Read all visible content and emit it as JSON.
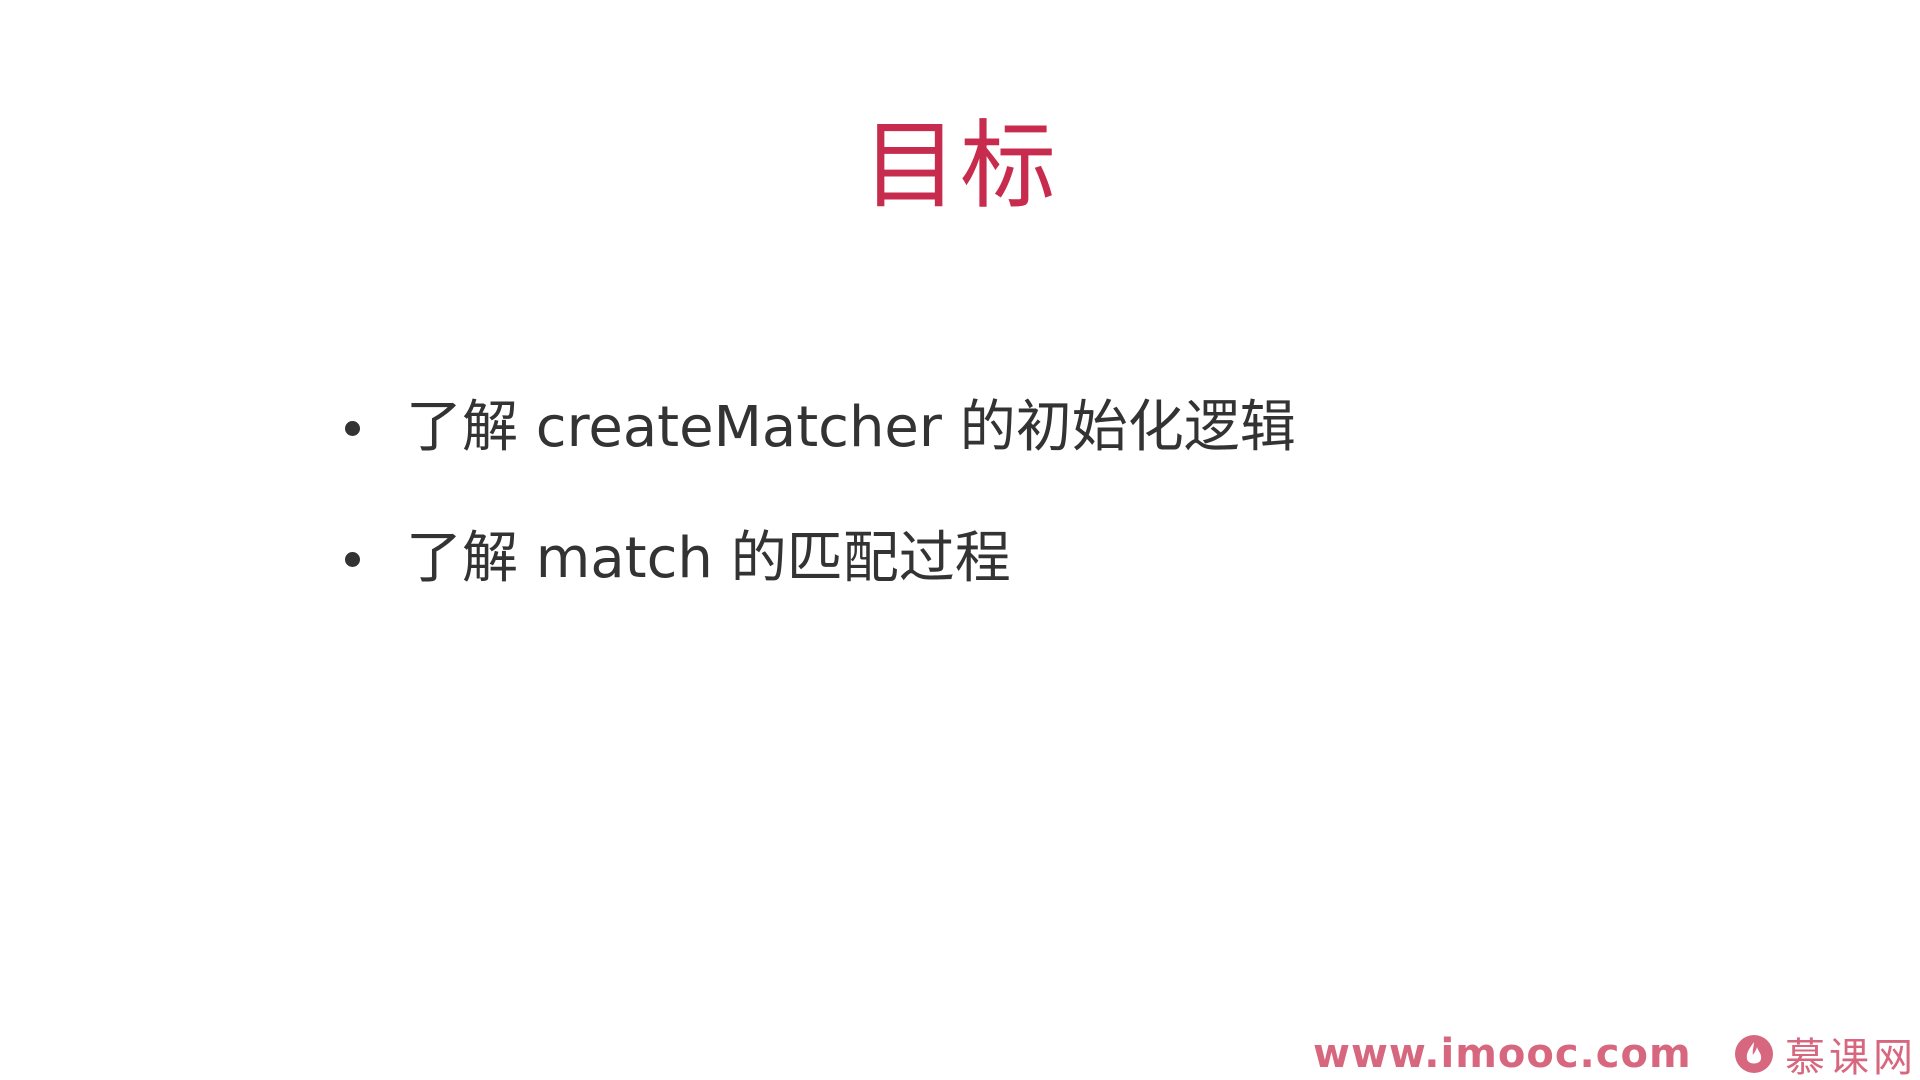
{
  "slide": {
    "title": "目标",
    "bullets": [
      {
        "text": "了解 createMatcher 的初始化逻辑"
      },
      {
        "text": "了解 match 的匹配过程"
      }
    ]
  },
  "watermark": {
    "url": "www.imooc.com",
    "brand": "慕课网",
    "logo_icon": "flame-icon"
  },
  "colors": {
    "title": "#c72c4e",
    "body_text": "#333333",
    "watermark": "#c72c4e",
    "background": "#ffffff"
  }
}
